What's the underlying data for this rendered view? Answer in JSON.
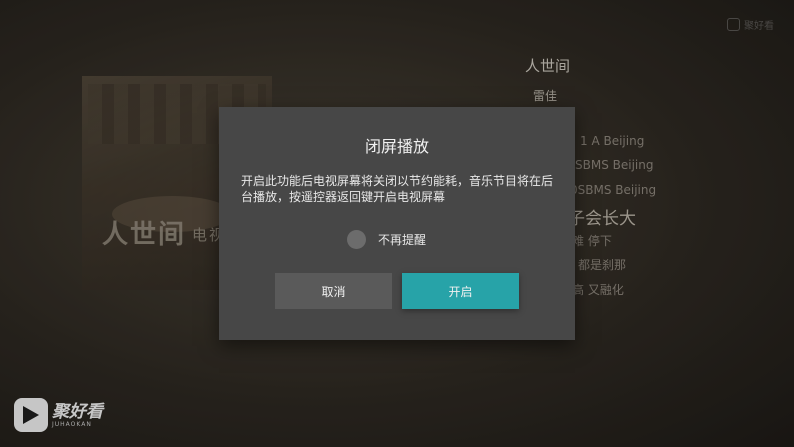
{
  "app": {
    "top_brand": "聚好看",
    "watermark_name": "聚好看",
    "watermark_sub": "JUHAOKAN"
  },
  "player": {
    "cover_title": "人世间",
    "cover_title_sub": "电视",
    "song_title": "人世间",
    "artist": "雷佳",
    "lyrics": [
      "1 A Beijing",
      "SBMS Beijing",
      "0SBMS Beijing",
      "子会长大",
      "难 停下",
      "都是刹那",
      "高 又融化"
    ]
  },
  "dialog": {
    "title": "闭屏播放",
    "message": "开启此功能后电视屏幕将关闭以节约能耗，音乐节目将在后台播放，按遥控器返回键开启电视屏幕",
    "checkbox_label": "不再提醒",
    "checkbox_checked": false,
    "cancel_label": "取消",
    "confirm_label": "开启"
  },
  "colors": {
    "accent": "#27a3a8",
    "dialog_bg": "#474747",
    "button_bg": "#5a5a5a"
  }
}
